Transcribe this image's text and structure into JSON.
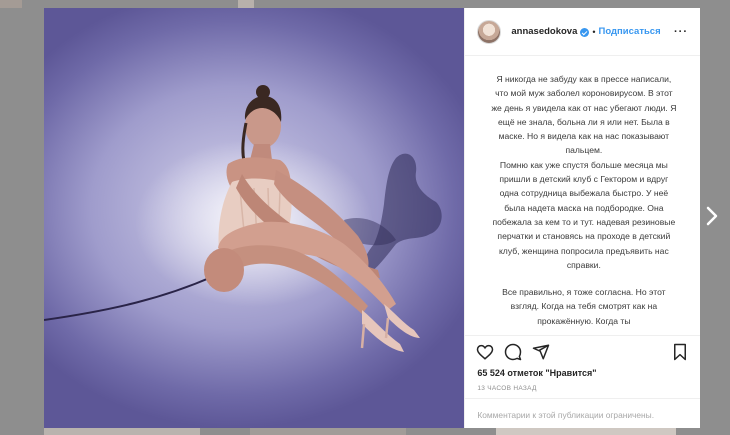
{
  "post": {
    "username": "annasedokova",
    "separator": "•",
    "follow_label": "Подписаться",
    "more_label": "···",
    "caption_paragraphs": [
      "Я никогда не забуду как в прессе написали, что мой муж заболел короновирусом. В этот же день я увидела как от нас убегают люди. Я ещё не знала, больна ли я или нет. Была в маске. Но я видела как на нас показывают пальцем.\nПомню как уже спустя больше месяца мы пришли в детский клуб с Гектором и вдруг одна сотрудница выбежала быстро. У неё была надета маска на подбородке. Она побежала за кем то и тут. надевая резиновые перчатки и становясь на проходе в детский клуб, женщина попросила предъявить нас справки.",
      "Все правильно, я тоже согласна. Но этот взгляд. Когда на тебя смотрят как на прокажённую. Когда ты"
    ],
    "likes_text": "65 524 отметок \"Нравится\"",
    "time_text": "13 ЧАСОВ НАЗАД",
    "comments_notice": "Комментарии к этой публикации ограничены."
  },
  "icons": {
    "like": "heart-icon",
    "comment": "comment-icon",
    "share": "share-icon",
    "save": "bookmark-icon",
    "next": "chevron-right-icon",
    "verified": "verified-badge-icon"
  },
  "colors": {
    "link_blue": "#3897f0",
    "text": "#262626",
    "muted": "#8e8e8e",
    "overlay": "#8e8e8e"
  }
}
